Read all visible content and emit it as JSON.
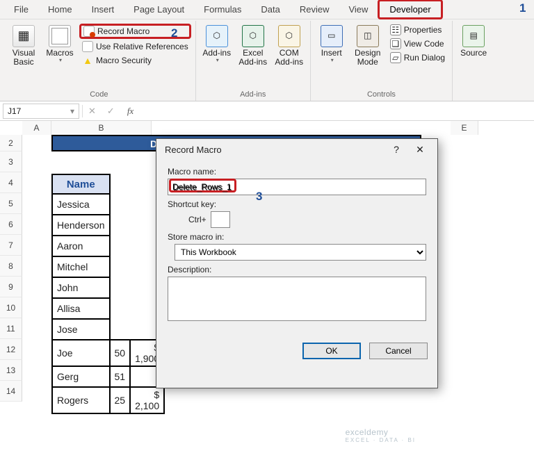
{
  "ribbon": {
    "tabs": [
      "File",
      "Home",
      "Insert",
      "Page Layout",
      "Formulas",
      "Data",
      "Review",
      "View",
      "Developer"
    ],
    "active_tab": "Developer",
    "groups": {
      "code": {
        "label": "Code",
        "visual_basic": "Visual Basic",
        "macros": "Macros",
        "record_macro": "Record Macro",
        "use_rel_refs": "Use Relative References",
        "macro_security": "Macro Security"
      },
      "addins": {
        "label": "Add-ins",
        "addins": "Add-ins",
        "excel_addins": "Excel Add-ins",
        "com_addins": "COM Add-ins"
      },
      "controls": {
        "label": "Controls",
        "insert": "Insert",
        "design_mode": "Design Mode",
        "properties": "Properties",
        "view_code": "View Code",
        "run_dialog": "Run Dialog"
      },
      "xml": {
        "source": "Source"
      }
    }
  },
  "namebox": "J17",
  "sheet": {
    "title_partial": "De",
    "visible_cols": [
      "A",
      "B",
      "E"
    ],
    "row_numbers": [
      "2",
      "3",
      "4",
      "5",
      "6",
      "7",
      "8",
      "9",
      "10",
      "11",
      "12",
      "13",
      "14"
    ],
    "header_name": "Name",
    "names": [
      "Jessica",
      "Henderson",
      "Aaron",
      "Mitchel",
      "John",
      "Allisa",
      "Jose",
      "Joe",
      "Gerg",
      "Rogers"
    ],
    "rows_tail": [
      {
        "qty": "50",
        "price": "$          1,900"
      },
      {
        "qty": "51",
        "price": ""
      },
      {
        "qty": "25",
        "price": "$          2,100"
      }
    ]
  },
  "dialog": {
    "title": "Record Macro",
    "lbl_name": "Macro name:",
    "macro_name": "Delete_Rows_1",
    "lbl_shortcut": "Shortcut key:",
    "shortcut_prefix": "Ctrl+",
    "shortcut_value": "",
    "lbl_store": "Store macro in:",
    "store_value": "This Workbook",
    "lbl_desc": "Description:",
    "desc_value": "",
    "ok": "OK",
    "cancel": "Cancel"
  },
  "annotations": {
    "n1": "1",
    "n2": "2",
    "n3": "3"
  },
  "watermark": {
    "line1": "exceldemy",
    "line2": "EXCEL · DATA · BI"
  }
}
